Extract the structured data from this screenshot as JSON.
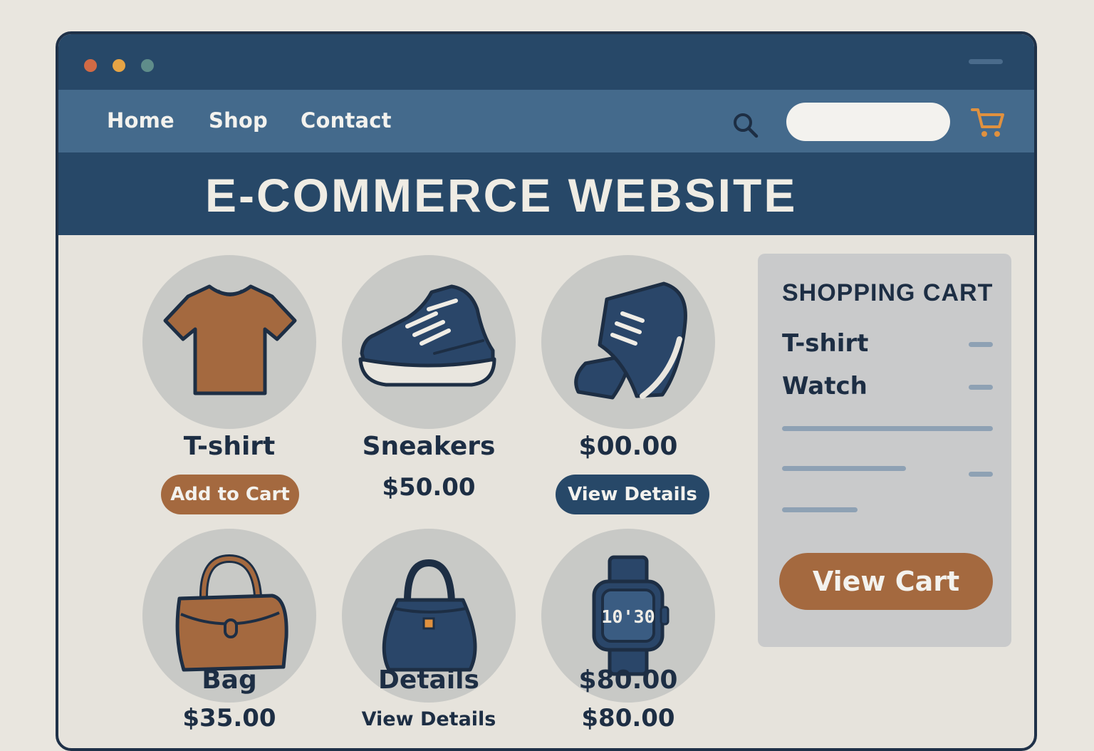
{
  "nav": {
    "home": "Home",
    "shop": "Shop",
    "contact": "Contact"
  },
  "search": {
    "placeholder": "",
    "value": ""
  },
  "banner": {
    "title": "E-COMMERCE WEBSITE"
  },
  "products": [
    {
      "name": "T-shirt",
      "button": "Add to Cart",
      "icon": "tshirt-icon"
    },
    {
      "name": "Sneakers",
      "price": "$50.00",
      "icon": "sneaker-icon"
    },
    {
      "price": "$00.00",
      "button": "View Details",
      "icon": "shoe-icon"
    },
    {
      "name": "Bag",
      "price": "$35.00",
      "icon": "bag-icon"
    },
    {
      "name": "Details",
      "link": "View Details",
      "icon": "handbag-icon"
    },
    {
      "price": "$80.00",
      "price2": "$80.00",
      "icon": "watch-icon",
      "watch_time": "10'30"
    }
  ],
  "cart": {
    "title": "SHOPPING CART",
    "items": [
      "T-shirt",
      "Watch"
    ],
    "button": "View Cart"
  },
  "colors": {
    "navy": "#274868",
    "nav": "#446a8c",
    "accent": "#a4693f",
    "panel": "#c9cacb"
  }
}
